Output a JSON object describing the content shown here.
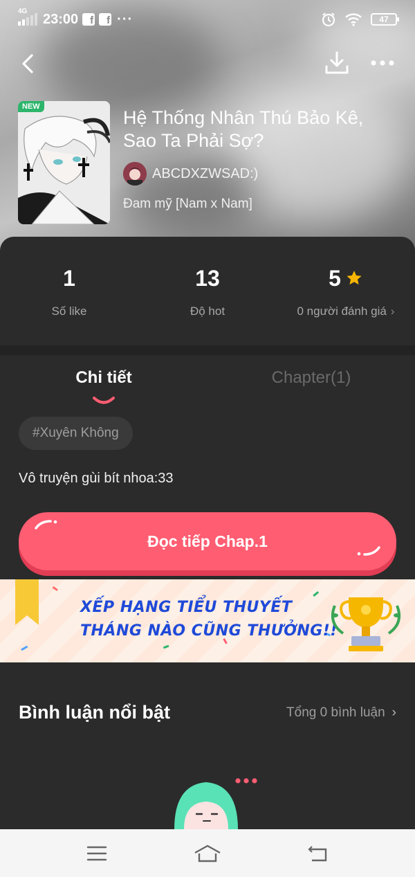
{
  "status_bar": {
    "network": "4G",
    "time": "23:00",
    "notification_icons": [
      "facebook-icon",
      "facebook-icon"
    ],
    "more_notifications": "···",
    "battery": "47"
  },
  "nav": {
    "back_icon": "chevron-left-icon",
    "download_icon": "download-icon",
    "more_icon": "more-horizontal-icon"
  },
  "story": {
    "badge": "NEW",
    "title": "Hệ Thống Nhân Thú Bảo Kê, Sao Ta Phải Sợ?",
    "author": "ABCDXZWSAD:)",
    "genre": "Đam mỹ [Nam x Nam]"
  },
  "stats": [
    {
      "value": "1",
      "label": "Số like"
    },
    {
      "value": "13",
      "label": "Độ hot"
    },
    {
      "value": "5",
      "label": "0 người đánh giá"
    }
  ],
  "tabs": [
    {
      "label": "Chi tiết",
      "active": true
    },
    {
      "label": "Chapter(1)",
      "active": false
    }
  ],
  "tag": "#Xuyên Không",
  "description": "Vô truyện gùi bít nhoa:33",
  "read_button": "Đọc tiếp Chap.1",
  "banner": {
    "line1": "XẾP HẠNG TIỂU THUYẾT",
    "line2": "THÁNG NÀO CŨNG THƯỞNG!!"
  },
  "comments": {
    "title": "Bình luận nổi bật",
    "total": "Tổng 0 bình luận"
  },
  "system_nav": [
    "menu-icon",
    "home-icon",
    "back-icon"
  ],
  "colors": {
    "accent": "#ff5d72",
    "panel": "#2b2b2b",
    "star": "#f7b500",
    "banner_text": "#1f4ad8"
  }
}
